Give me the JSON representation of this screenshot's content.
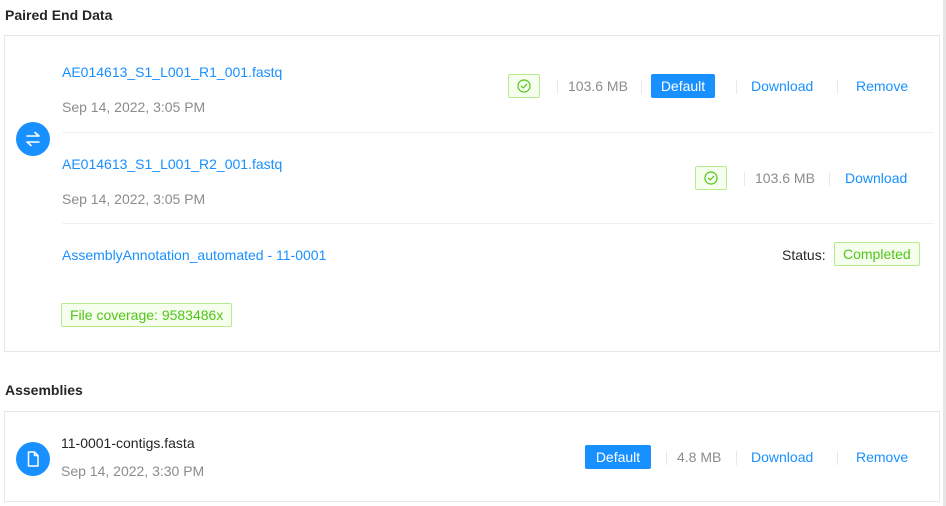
{
  "paired_section": {
    "title": "Paired End Data",
    "icon": "swap-arrows-icon",
    "files": [
      {
        "name": "AE014613_S1_L001_R1_001.fastq",
        "date": "Sep 14, 2022, 3:05 PM",
        "size": "103.6 MB",
        "default_label": "Default",
        "download_label": "Download",
        "remove_label": "Remove"
      },
      {
        "name": "AE014613_S1_L001_R2_001.fastq",
        "date": "Sep 14, 2022, 3:05 PM",
        "size": "103.6 MB",
        "download_label": "Download"
      }
    ],
    "analysis": {
      "name": "AssemblyAnnotation_automated - 11-0001",
      "status_label": "Status:",
      "status_value": "Completed",
      "coverage": "File coverage: 9583486x"
    }
  },
  "assemblies_section": {
    "title": "Assemblies",
    "icon": "file-icon",
    "files": [
      {
        "name": "11-0001-contigs.fasta",
        "date": "Sep 14, 2022, 3:30 PM",
        "default_label": "Default",
        "size": "4.8 MB",
        "download_label": "Download",
        "remove_label": "Remove"
      }
    ]
  },
  "colors": {
    "primary": "#1890ff",
    "success": "#52c41a",
    "success_bg": "#f6ffed",
    "muted": "#8c8c8c"
  }
}
